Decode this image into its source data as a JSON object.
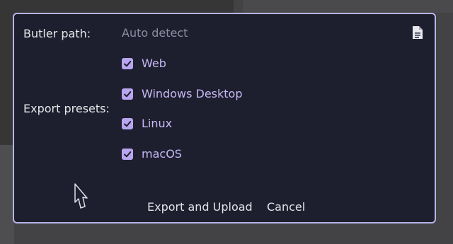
{
  "dialog": {
    "butler_path_label": "Butler path:",
    "butler_path_placeholder": "Auto detect",
    "export_presets_label": "Export presets:",
    "presets": [
      {
        "label": "Web",
        "checked": true
      },
      {
        "label": "Windows Desktop",
        "checked": true
      },
      {
        "label": "Linux",
        "checked": true
      },
      {
        "label": "macOS",
        "checked": true
      }
    ],
    "export_upload_label": "Export and Upload",
    "cancel_label": "Cancel"
  },
  "colors": {
    "dialog_bg": "#1e1f2e",
    "border": "#b8b4e8",
    "checkbox": "#b9a6f0",
    "preset_text": "#c6b8f6",
    "placeholder_text": "#8e8ea3"
  },
  "icons": {
    "file_browse": "file-icon",
    "checkmark": "check-icon",
    "cursor": "mouse-cursor-icon"
  }
}
